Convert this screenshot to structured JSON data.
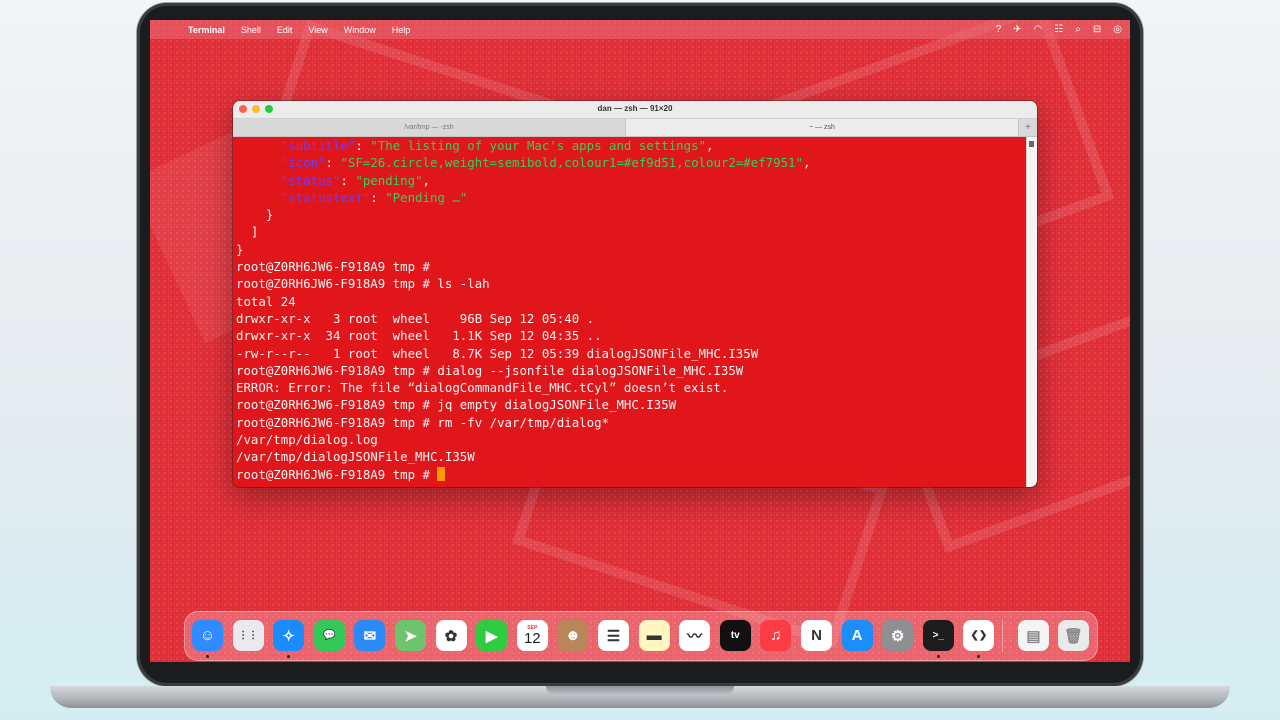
{
  "menubar": {
    "apple": "",
    "items": [
      "Terminal",
      "Shell",
      "Edit",
      "View",
      "Window",
      "Help"
    ],
    "status_icons": [
      "help-icon",
      "airplane-icon",
      "wifi-icon",
      "control-strip-icon",
      "search-icon",
      "control-center-icon",
      "siri-icon"
    ]
  },
  "window": {
    "title": "dan — zsh — 91×20",
    "tabs": [
      {
        "label": "/var/tmp — -zsh",
        "active": false
      },
      {
        "label": "~ — zsh",
        "active": true
      }
    ],
    "new_tab": "+"
  },
  "terminal": {
    "lines": [
      {
        "indent": "      ",
        "key": "\"subtitle\"",
        "sep": ": ",
        "val": "\"The listing of your Mac's apps and settings\"",
        "end": ","
      },
      {
        "indent": "      ",
        "key": "\"icon\"",
        "sep": ": ",
        "val": "\"SF=26.circle,weight=semibold,colour1=#ef9d51,colour2=#ef7951\"",
        "end": ","
      },
      {
        "indent": "      ",
        "key": "\"status\"",
        "sep": ": ",
        "val": "\"pending\"",
        "end": ","
      },
      {
        "indent": "      ",
        "key": "\"statustext\"",
        "sep": ": ",
        "val": "\"Pending …\"",
        "end": ""
      }
    ],
    "plain": [
      "    }",
      "  ]",
      "}",
      "root@Z0RH6JW6-F918A9 tmp #",
      "root@Z0RH6JW6-F918A9 tmp # ls -lah",
      "total 24",
      "drwxr-xr-x   3 root  wheel    96B Sep 12 05:40 .",
      "drwxr-xr-x  34 root  wheel   1.1K Sep 12 04:35 ..",
      "-rw-r--r--   1 root  wheel   8.7K Sep 12 05:39 dialogJSONFile_MHC.I35W",
      "root@Z0RH6JW6-F918A9 tmp # dialog --jsonfile dialogJSONFile_MHC.I35W",
      "ERROR: Error: The file “dialogCommandFile_MHC.tCyl” doesn’t exist.",
      "root@Z0RH6JW6-F918A9 tmp # jq empty dialogJSONFile_MHC.I35W",
      "root@Z0RH6JW6-F918A9 tmp # rm -fv /var/tmp/dialog*",
      "/var/tmp/dialog.log",
      "/var/tmp/dialogJSONFile_MHC.I35W"
    ],
    "prompt": "root@Z0RH6JW6-F918A9 tmp # "
  },
  "dock": {
    "calendar_month": "SEP",
    "calendar_day": "12",
    "apps": [
      {
        "name": "Finder",
        "icon": "finder-icon",
        "color": "#2f8bff",
        "glyph": "☺",
        "running": true
      },
      {
        "name": "Launchpad",
        "icon": "launchpad-icon",
        "color": "#e9e9ef",
        "glyph": "⋮⋮",
        "running": false
      },
      {
        "name": "Safari",
        "icon": "safari-icon",
        "color": "#1a8cff",
        "glyph": "✧",
        "running": true
      },
      {
        "name": "Messages",
        "icon": "messages-icon",
        "color": "#34c759",
        "glyph": "💬",
        "running": false
      },
      {
        "name": "Mail",
        "icon": "mail-icon",
        "color": "#2a8af6",
        "glyph": "✉",
        "running": false
      },
      {
        "name": "Maps",
        "icon": "maps-icon",
        "color": "#6cc56c",
        "glyph": "➤",
        "running": false
      },
      {
        "name": "Photos",
        "icon": "photos-icon",
        "color": "#ffffff",
        "glyph": "✿",
        "running": false
      },
      {
        "name": "FaceTime",
        "icon": "facetime-icon",
        "color": "#2ecc40",
        "glyph": "▶",
        "running": false
      },
      {
        "name": "Calendar",
        "icon": "calendar-icon",
        "color": "#ffffff",
        "glyph": "",
        "running": false
      },
      {
        "name": "Contacts",
        "icon": "contacts-icon",
        "color": "#b9865a",
        "glyph": "☻",
        "running": false
      },
      {
        "name": "Reminders",
        "icon": "reminders-icon",
        "color": "#ffffff",
        "glyph": "☰",
        "running": false
      },
      {
        "name": "Notes",
        "icon": "notes-icon",
        "color": "#fff6c2",
        "glyph": "▬",
        "running": false
      },
      {
        "name": "Freeform",
        "icon": "freeform-icon",
        "color": "#ffffff",
        "glyph": "〰",
        "running": false
      },
      {
        "name": "TV",
        "icon": "tv-icon",
        "color": "#111111",
        "glyph": "tv",
        "running": false
      },
      {
        "name": "Music",
        "icon": "music-icon",
        "color": "#fc3c44",
        "glyph": "♫",
        "running": false
      },
      {
        "name": "News",
        "icon": "news-icon",
        "color": "#ffffff",
        "glyph": "N",
        "running": false
      },
      {
        "name": "App Store",
        "icon": "app-store-icon",
        "color": "#1c8ef9",
        "glyph": "A",
        "running": false
      },
      {
        "name": "System Settings",
        "icon": "system-settings-icon",
        "color": "#8e8e93",
        "glyph": "⚙",
        "running": false
      },
      {
        "name": "Terminal",
        "icon": "terminal-icon",
        "color": "#1c1c1e",
        "glyph": ">_",
        "running": true
      },
      {
        "name": "Visual Studio Code",
        "icon": "vscode-icon",
        "color": "#ffffff",
        "glyph": "❮❯",
        "running": true
      }
    ],
    "extras": [
      {
        "name": "Documents",
        "icon": "document-stack-icon",
        "color": "#f4f4f4",
        "glyph": "▤"
      },
      {
        "name": "Trash",
        "icon": "trash-icon",
        "color": "#eaeaea",
        "glyph": "🗑"
      }
    ]
  }
}
